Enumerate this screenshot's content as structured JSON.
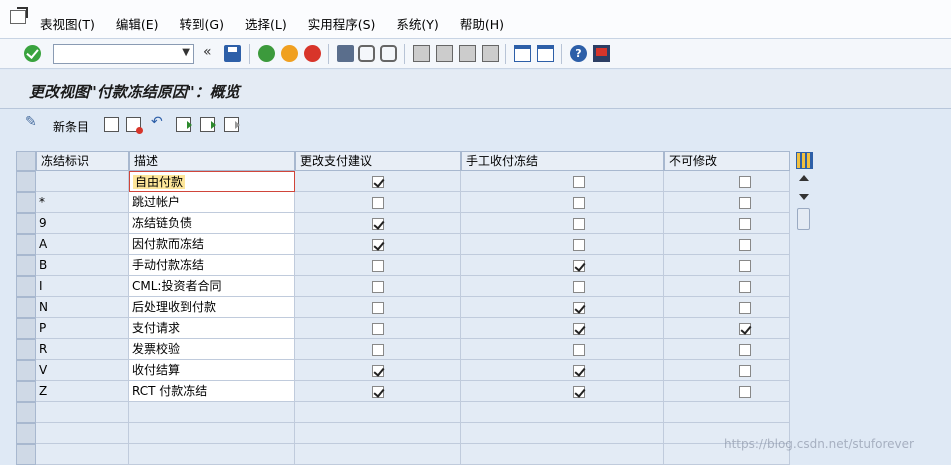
{
  "menu": {
    "items": [
      "表视图(T)",
      "编辑(E)",
      "转到(G)",
      "选择(L)",
      "实用程序(S)",
      "系统(Y)",
      "帮助(H)"
    ]
  },
  "toolbar": {
    "command_value": "",
    "back_arrows": "«",
    "help_glyph": "?"
  },
  "title": "更改视图\"付款冻结原因\"：概览",
  "app_toolbar": {
    "new_entries_label": "新条目"
  },
  "table": {
    "headers": [
      "冻结标识",
      "描述",
      "更改支付建议",
      "手工收付冻结",
      "不可修改"
    ],
    "rows": [
      {
        "key": "",
        "desc": "自由付款",
        "change_proposal": true,
        "manual_block": false,
        "no_change": false
      },
      {
        "key": "*",
        "desc": "跳过帐户",
        "change_proposal": false,
        "manual_block": false,
        "no_change": false
      },
      {
        "key": "9",
        "desc": "冻结链负债",
        "change_proposal": true,
        "manual_block": false,
        "no_change": false
      },
      {
        "key": "A",
        "desc": "因付款而冻结",
        "change_proposal": true,
        "manual_block": false,
        "no_change": false
      },
      {
        "key": "B",
        "desc": "手动付款冻结",
        "change_proposal": false,
        "manual_block": true,
        "no_change": false
      },
      {
        "key": "I",
        "desc": "CML:投资者合同",
        "change_proposal": false,
        "manual_block": false,
        "no_change": false
      },
      {
        "key": "N",
        "desc": "后处理收到付款",
        "change_proposal": false,
        "manual_block": true,
        "no_change": false
      },
      {
        "key": "P",
        "desc": "支付请求",
        "change_proposal": false,
        "manual_block": true,
        "no_change": true
      },
      {
        "key": "R",
        "desc": "发票校验",
        "change_proposal": false,
        "manual_block": false,
        "no_change": false
      },
      {
        "key": "V",
        "desc": "收付结算",
        "change_proposal": true,
        "manual_block": true,
        "no_change": false
      },
      {
        "key": "Z",
        "desc": "RCT 付款冻结",
        "change_proposal": true,
        "manual_block": true,
        "no_change": false
      }
    ]
  },
  "watermark": "https://blog.csdn.net/stuforever"
}
